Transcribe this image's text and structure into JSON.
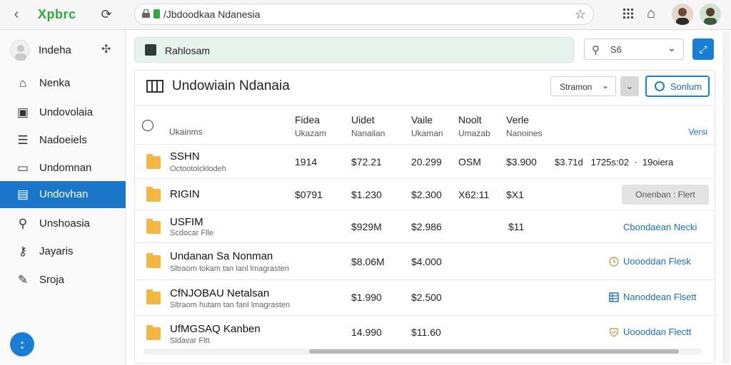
{
  "browser": {
    "brand": "Xpbrc",
    "url": "/Jbdoodkaa Ndanesia"
  },
  "sidebar": {
    "profile_name": "Indeha",
    "items": [
      {
        "label": "Nenka",
        "icon": "home-icon"
      },
      {
        "label": "Undovolaia",
        "icon": "window-icon"
      },
      {
        "label": "Nadoeiels",
        "icon": "document-icon"
      },
      {
        "label": "Undomnan",
        "icon": "folder-icon"
      },
      {
        "label": "Undovhan",
        "icon": "calendar-icon",
        "active": true
      },
      {
        "label": "Unshoasia",
        "icon": "search-icon"
      },
      {
        "label": "Jayaris",
        "icon": "key-icon"
      },
      {
        "label": "Sroja",
        "icon": "chat-icon"
      }
    ],
    "fab_label": ":"
  },
  "banner": {
    "text": "Rahlosam"
  },
  "search": {
    "value": "S6"
  },
  "panel": {
    "title": "Undowiain Ndanaia",
    "dropdown_label": "Stramon",
    "outline_button_label": "Sonlum"
  },
  "table": {
    "headers": [
      {
        "title": "Fidea",
        "sub": "Ukazam"
      },
      {
        "title": "Uidet",
        "sub": "Nanailan"
      },
      {
        "title": "Vaile",
        "sub": "Ukaman"
      },
      {
        "title": "Noolt",
        "sub": "Umazab"
      },
      {
        "title": "Verle",
        "sub": "Nanoines"
      }
    ],
    "first_col_sub": "Ukainms",
    "right_header": "Versi",
    "rows": [
      {
        "name": "SSHN",
        "sub": "Octootolcklodeh",
        "c1": "1914",
        "c2": "$72.21",
        "c3": "20.299",
        "c4": "OSM",
        "c5": "$3.900",
        "extra": "$3.71d   1725s:02  ·  19oiera"
      },
      {
        "name": "RIGIN",
        "sub": "",
        "c1": "$0791",
        "c2": "$1.230",
        "c3": "$2.300",
        "c4": "X62:11",
        "c5": "$X1",
        "action_button": "Onenban : Flert"
      },
      {
        "name": "USFIM",
        "sub": "Scdocar Flle",
        "c1": "",
        "c2": "$929M",
        "c3": "$2.986",
        "c4": "",
        "c5": "$11",
        "action_link": "Cbondaean Necki"
      },
      {
        "name": "Undanan Sa Nonman",
        "sub": "Sltraom tokam tan lanl lmagrasten",
        "c1": "",
        "c2": "$8.06M",
        "c3": "$4.000",
        "c4": "",
        "c5": "",
        "action_link": "Uoooddan Flesk",
        "action_icon": "clock-icon"
      },
      {
        "name": "CfNJOBAU Netalsan",
        "sub": "Sltraom hutam tan fanl lmagrasten",
        "c1": "",
        "c2": "$1.990",
        "c3": "$2.500",
        "c4": "",
        "c5": "",
        "action_link": "Nanoddean Flsett",
        "action_icon": "table-icon"
      },
      {
        "name": "UfMGSAQ Kanben",
        "sub": "Sldavar Fltt",
        "c1": "",
        "c2": "14.990",
        "c3": "$11.60",
        "c4": "",
        "c5": "",
        "action_link": "Uoooddan Flectt",
        "action_icon": "badge-icon"
      }
    ]
  },
  "colors": {
    "accent": "#1976c9",
    "brand_green": "#2eaa3a",
    "folder": "#f5b642",
    "banner_bg": "#e6f3ec"
  }
}
